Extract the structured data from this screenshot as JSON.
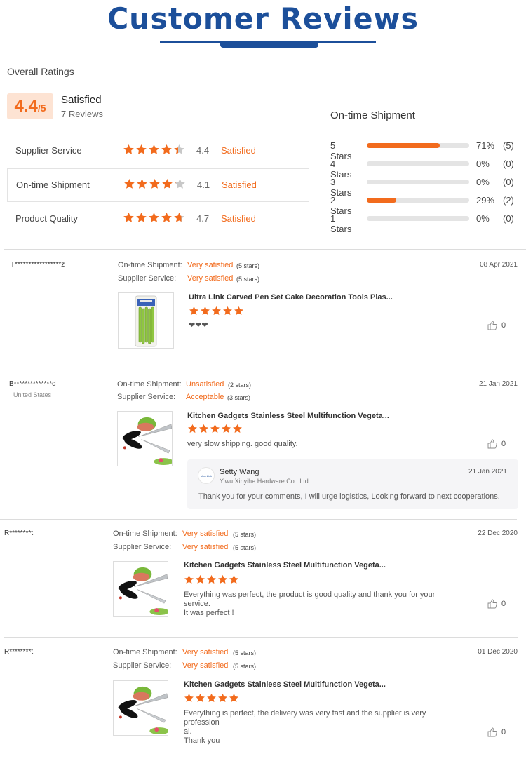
{
  "header": {
    "title": "Customer Reviews"
  },
  "summary": {
    "overall_label": "Overall Ratings",
    "score": "4.4",
    "score_max": "/5",
    "status": "Satisfied",
    "review_count": "7 Reviews",
    "accent_color": "#f26b1d",
    "star_color": "#f26b1d",
    "rows": [
      {
        "label": "Supplier Service",
        "rating": 4.4,
        "score": "4.4",
        "status": "Satisfied"
      },
      {
        "label": "On-time Shipment",
        "rating": 4.1,
        "score": "4.1",
        "status": "Satisfied"
      },
      {
        "label": "Product Quality",
        "rating": 4.7,
        "score": "4.7",
        "status": "Satisfied"
      }
    ]
  },
  "shipment": {
    "title": "On-time Shipment",
    "rows": [
      {
        "label": "5 Stars",
        "fraction": 0.71,
        "pct": "71%",
        "count": "(5)"
      },
      {
        "label": "4 Stars",
        "fraction": 0,
        "pct": "0%",
        "count": "(0)"
      },
      {
        "label": "3 Stars",
        "fraction": 0,
        "pct": "0%",
        "count": "(0)"
      },
      {
        "label": "2 Stars",
        "fraction": 0.29,
        "pct": "29%",
        "count": "(2)"
      },
      {
        "label": "1 Stars",
        "fraction": 0,
        "pct": "0%",
        "count": "(0)"
      }
    ]
  },
  "reviews": [
    {
      "name": "T*****************z",
      "country": "",
      "shipment_label": "On-time Shipment:",
      "shipment_value": "Very satisfied",
      "shipment_stars": "(5 stars)",
      "service_label": "Supplier Service:",
      "service_value": "Very satisfied",
      "service_stars": "(5 stars)",
      "date": "08 Apr 2021",
      "product": "Ultra Link Carved Pen Set Cake Decoration Tools Plas...",
      "rating": 5,
      "body": [
        "❤❤❤"
      ],
      "likes": "0",
      "thumb_icon": "pen-set-icon"
    },
    {
      "name": "B**************d",
      "country": "United States",
      "shipment_label": "On-time Shipment:",
      "shipment_value": "Unsatisfied",
      "shipment_stars": "(2 stars)",
      "service_label": "Supplier Service:",
      "service_value": "Acceptable",
      "service_stars": "(3 stars)",
      "date": "21 Jan 2021",
      "product": "Kitchen Gadgets Stainless Steel Multifunction Vegeta...",
      "rating": 5,
      "body": [
        "very slow shipping.  good quality."
      ],
      "likes": "0",
      "thumb_icon": "kitchen-scissors-icon",
      "reply": {
        "name": "Setty Wang",
        "company": "Yiwu Xinyihe Hardware Co., Ltd.",
        "date": "21 Jan 2021",
        "text": "Thank you for your comments, I will urge logistics,   Looking forward to next cooperations.",
        "logo_text": "ultra Link"
      }
    },
    {
      "name": "R********t",
      "country": "",
      "shipment_label": "On-time Shipment:",
      "shipment_value": "Very satisfied",
      "shipment_stars": "(5 stars)",
      "service_label": "Supplier Service:",
      "service_value": "Very satisfied",
      "service_stars": "(5 stars)",
      "date": "22 Dec 2020",
      "product": "Kitchen Gadgets Stainless Steel Multifunction Vegeta...",
      "rating": 5,
      "body": [
        "Everything was perfect, the product is good quality and thank you for your service.",
        "It was perfect !"
      ],
      "likes": "0",
      "thumb_icon": "kitchen-scissors-icon"
    },
    {
      "name": "R********t",
      "country": "",
      "shipment_label": "On-time Shipment:",
      "shipment_value": "Very satisfied",
      "shipment_stars": "(5 stars)",
      "service_label": "Supplier Service:",
      "service_value": "Very satisfied",
      "service_stars": "(5 stars)",
      "date": "01 Dec 2020",
      "product": "Kitchen Gadgets Stainless Steel Multifunction Vegeta...",
      "rating": 5,
      "body": [
        "Everything is perfect, the delivery was very fast and the supplier is very profession",
        "al.",
        "Thank you"
      ],
      "likes": "0",
      "thumb_icon": "kitchen-scissors-icon"
    }
  ]
}
